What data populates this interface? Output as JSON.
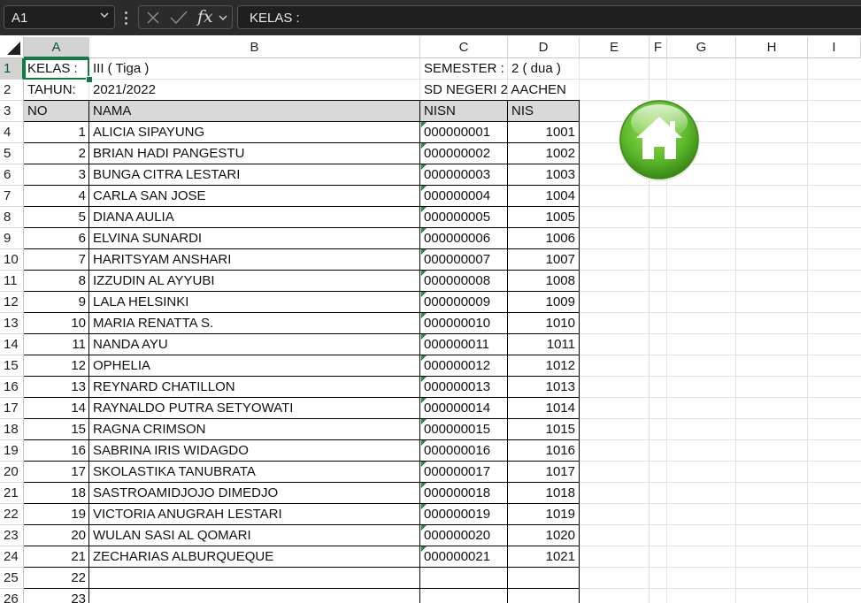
{
  "formula_bar": {
    "name_box": "A1",
    "cancel_icon": "close-icon",
    "enter_icon": "check-icon",
    "function_label": "fx",
    "content": "KELAS :"
  },
  "columns": [
    "A",
    "B",
    "C",
    "D",
    "E",
    "F",
    "G",
    "H",
    "I"
  ],
  "selected_cell": "A1",
  "info": {
    "kelas_label": "KELAS :",
    "kelas_value": "III ( Tiga )",
    "semester_label": "SEMESTER :",
    "semester_value": "2 ( dua )",
    "tahun_label": "TAHUN:",
    "tahun_value": "2021/2022",
    "school": "SD NEGERI 2 AACHEN"
  },
  "table": {
    "headers": [
      "NO",
      "NAMA",
      "NISN",
      "NIS"
    ],
    "header_fill": "#d9d9d9",
    "rows": [
      {
        "no": "1",
        "nama": "ALICIA SIPAYUNG",
        "nisn": "000000001",
        "nis": "1001"
      },
      {
        "no": "2",
        "nama": "BRIAN HADI PANGESTU",
        "nisn": "000000002",
        "nis": "1002"
      },
      {
        "no": "3",
        "nama": "BUNGA CITRA LESTARI",
        "nisn": "000000003",
        "nis": "1003"
      },
      {
        "no": "4",
        "nama": "CARLA SAN JOSE",
        "nisn": "000000004",
        "nis": "1004"
      },
      {
        "no": "5",
        "nama": "DIANA AULIA",
        "nisn": "000000005",
        "nis": "1005"
      },
      {
        "no": "6",
        "nama": "ELVINA SUNARDI",
        "nisn": "000000006",
        "nis": "1006"
      },
      {
        "no": "7",
        "nama": "HARITSYAM ANSHARI",
        "nisn": "000000007",
        "nis": "1007"
      },
      {
        "no": "8",
        "nama": "IZZUDIN AL AYYUBI",
        "nisn": "000000008",
        "nis": "1008"
      },
      {
        "no": "9",
        "nama": "LALA HELSINKI",
        "nisn": "000000009",
        "nis": "1009"
      },
      {
        "no": "10",
        "nama": "MARIA RENATTA S.",
        "nisn": "000000010",
        "nis": "1010"
      },
      {
        "no": "11",
        "nama": "NANDA AYU",
        "nisn": "000000011",
        "nis": "1011"
      },
      {
        "no": "12",
        "nama": "OPHELIA",
        "nisn": "000000012",
        "nis": "1012"
      },
      {
        "no": "13",
        "nama": "REYNARD CHATILLON",
        "nisn": "000000013",
        "nis": "1013"
      },
      {
        "no": "14",
        "nama": "RAYNALDO PUTRA SETYOWATI",
        "nisn": "000000014",
        "nis": "1014"
      },
      {
        "no": "15",
        "nama": "RAGNA CRIMSON",
        "nisn": "000000015",
        "nis": "1015"
      },
      {
        "no": "16",
        "nama": "SABRINA IRIS WIDAGDO",
        "nisn": "000000016",
        "nis": "1016"
      },
      {
        "no": "17",
        "nama": "SKOLASTIKA TANUBRATA",
        "nisn": "000000017",
        "nis": "1017"
      },
      {
        "no": "18",
        "nama": "SASTROAMIDJOJO DIMEDJO",
        "nisn": "000000018",
        "nis": "1018"
      },
      {
        "no": "19",
        "nama": "VICTORIA ANUGRAH LESTARI",
        "nisn": "000000019",
        "nis": "1019"
      },
      {
        "no": "20",
        "nama": "WULAN SASI AL QOMARI",
        "nisn": "000000020",
        "nis": "1020"
      },
      {
        "no": "21",
        "nama": "ZECHARIAS ALBURQUEQUE",
        "nisn": "000000021",
        "nis": "1021"
      },
      {
        "no": "22",
        "nama": "",
        "nisn": "",
        "nis": ""
      },
      {
        "no": "23",
        "nama": "",
        "nisn": "",
        "nis": ""
      }
    ]
  },
  "home_button": {
    "icon": "home-icon",
    "color": "#5cb82a"
  },
  "colors": {
    "accent": "#107c41",
    "toolbar": "#2b2b2b",
    "text_indicator": "#1e8a3e"
  }
}
